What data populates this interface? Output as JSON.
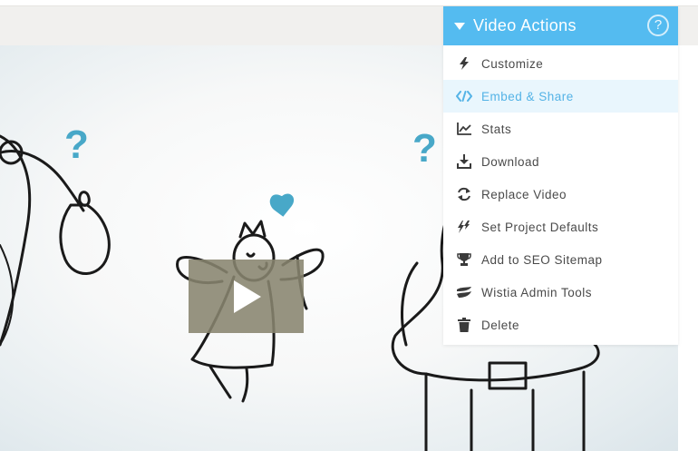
{
  "menu": {
    "title": "Video Actions",
    "help_glyph": "?",
    "items": [
      {
        "label": "Customize",
        "icon": "lightning-icon"
      },
      {
        "label": "Embed & Share",
        "icon": "code-icon"
      },
      {
        "label": "Stats",
        "icon": "chart-icon"
      },
      {
        "label": "Download",
        "icon": "download-icon"
      },
      {
        "label": "Replace Video",
        "icon": "refresh-icon"
      },
      {
        "label": "Set Project Defaults",
        "icon": "double-lightning-icon"
      },
      {
        "label": "Add to SEO Sitemap",
        "icon": "trophy-icon"
      },
      {
        "label": "Wistia Admin Tools",
        "icon": "wistia-icon"
      },
      {
        "label": "Delete",
        "icon": "trash-icon"
      }
    ],
    "active_item": "Embed & Share"
  },
  "video": {
    "annotations": [
      "?",
      "?"
    ]
  },
  "colors": {
    "accent": "#54bbf0",
    "active_bg": "#e9f6fd",
    "active_text": "#54b3e6",
    "item_text": "#4a4a4a",
    "play_button": "#87846e",
    "header_strip": "#f1f0ee"
  }
}
